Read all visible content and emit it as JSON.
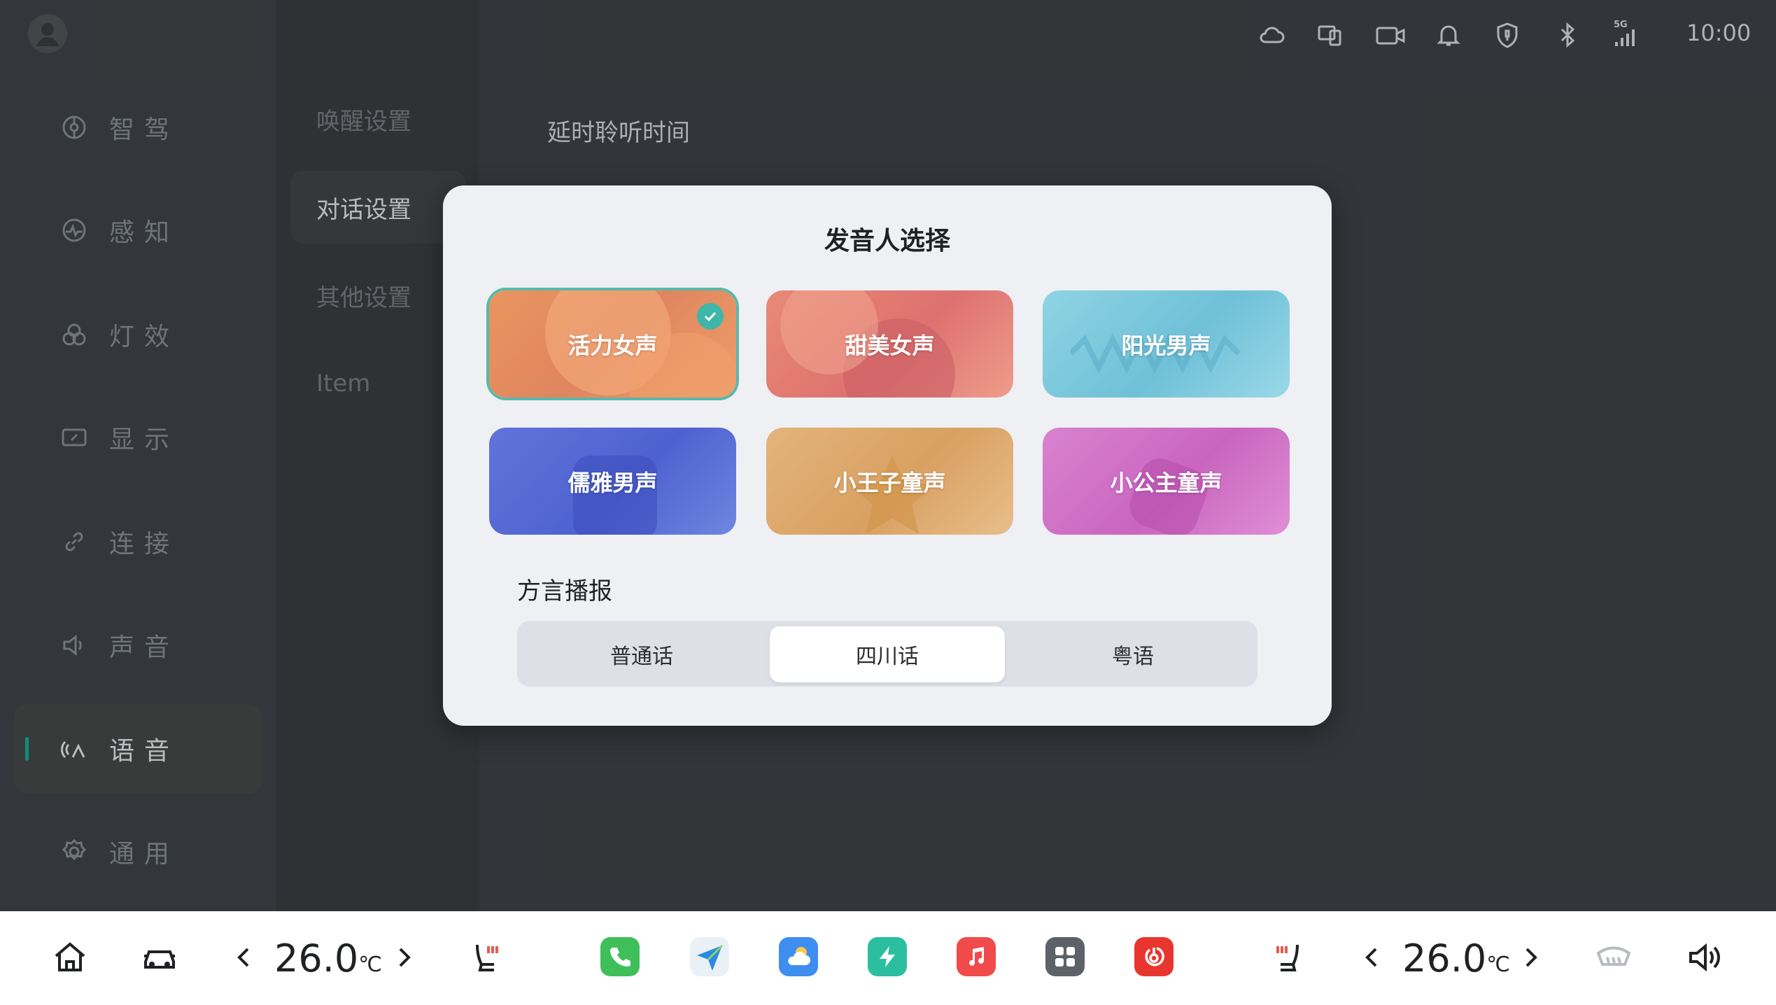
{
  "status_bar": {
    "time": "10:00",
    "network": "5G"
  },
  "left_nav": {
    "items": [
      {
        "label": "智驾",
        "icon": "steering-icon"
      },
      {
        "label": "感知",
        "icon": "perception-icon"
      },
      {
        "label": "灯效",
        "icon": "light-icon"
      },
      {
        "label": "显示",
        "icon": "display-icon"
      },
      {
        "label": "连接",
        "icon": "link-icon"
      },
      {
        "label": "声音",
        "icon": "speaker-icon"
      },
      {
        "label": "语音",
        "icon": "voice-icon",
        "active": true
      },
      {
        "label": "通用",
        "icon": "gear-icon"
      }
    ]
  },
  "sub_nav": {
    "items": [
      {
        "label": "唤醒设置"
      },
      {
        "label": "对话设置",
        "active": true
      },
      {
        "label": "其他设置"
      },
      {
        "label": "Item"
      }
    ]
  },
  "content": {
    "section_title": "延时聆听时间"
  },
  "modal": {
    "title": "发音人选择",
    "voices": [
      {
        "label": "活力女声",
        "selected": true,
        "color": "#e8935c"
      },
      {
        "label": "甜美女声",
        "color": "#e57f7a"
      },
      {
        "label": "阳光男声",
        "color": "#7ccbdc"
      },
      {
        "label": "儒雅男声",
        "color": "#5a6fd6"
      },
      {
        "label": "小王子童声",
        "color": "#dfaa6a"
      },
      {
        "label": "小公主童声",
        "color": "#d873c9"
      }
    ],
    "dialect_title": "方言播报",
    "dialects": [
      {
        "label": "普通话"
      },
      {
        "label": "四川话",
        "selected": true
      },
      {
        "label": "粤语"
      }
    ]
  },
  "dock": {
    "left_temp": "26.0",
    "right_temp": "26.0",
    "temp_unit": "℃"
  },
  "colors": {
    "accent": "#14a08d",
    "check": "#3fb7a8"
  }
}
